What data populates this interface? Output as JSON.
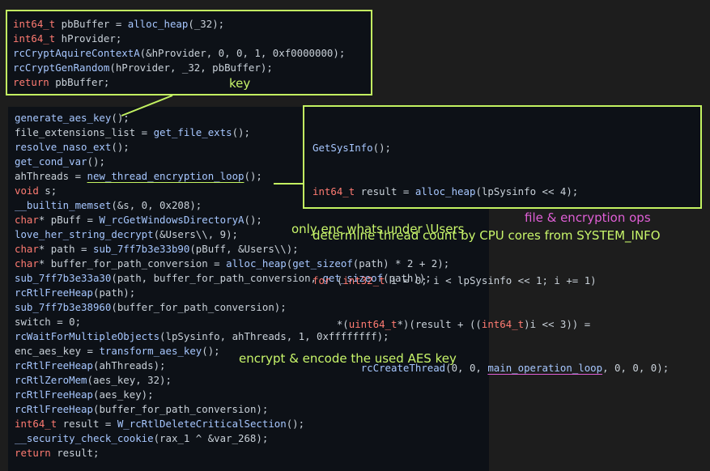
{
  "top_box": {
    "lines": [
      [
        {
          "c": "kw",
          "t": "int64_t"
        },
        {
          "c": "txt",
          "t": " pbBuffer = "
        },
        {
          "c": "fn",
          "t": "alloc_heap"
        },
        {
          "c": "txt",
          "t": "(_32);"
        }
      ],
      [
        {
          "c": "kw",
          "t": "int64_t"
        },
        {
          "c": "txt",
          "t": " hProvider;"
        }
      ],
      [
        {
          "c": "fn",
          "t": "rcCryptAquireContextA"
        },
        {
          "c": "txt",
          "t": "(&hProvider, 0, 0, 1, 0xf0000000);"
        }
      ],
      [
        {
          "c": "fn",
          "t": "rcCryptGenRandom"
        },
        {
          "c": "txt",
          "t": "(hProvider, _32, pbBuffer);"
        }
      ],
      [
        {
          "c": "kw",
          "t": "return"
        },
        {
          "c": "txt",
          "t": " pbBuffer;"
        }
      ]
    ],
    "annotation": "key"
  },
  "main_box": {
    "lines": [
      [
        {
          "c": "fn",
          "t": "generate_aes_key"
        },
        {
          "c": "txt",
          "t": "();"
        }
      ],
      [
        {
          "c": "txt",
          "t": "file_extensions_list = "
        },
        {
          "c": "fn",
          "t": "get_file_exts"
        },
        {
          "c": "txt",
          "t": "();"
        }
      ],
      [
        {
          "c": "fn",
          "t": "resolve_naso_ext"
        },
        {
          "c": "txt",
          "t": "();"
        }
      ],
      [
        {
          "c": "fn",
          "t": "get_cond_var"
        },
        {
          "c": "txt",
          "t": "();"
        }
      ],
      [
        {
          "c": "txt",
          "t": "ahThreads = "
        },
        {
          "c": "fnu",
          "t": "new_thread_encryption_loop"
        },
        {
          "c": "txt",
          "t": "();"
        }
      ],
      [
        {
          "c": "kw",
          "t": "void"
        },
        {
          "c": "txt",
          "t": " s;"
        }
      ],
      [
        {
          "c": "fn",
          "t": "__builtin_memset"
        },
        {
          "c": "txt",
          "t": "(&s, 0, 0x208);"
        }
      ],
      [
        {
          "c": "kw",
          "t": "char"
        },
        {
          "c": "txt",
          "t": "* pBuff = "
        },
        {
          "c": "fn",
          "t": "W_rcGetWindowsDirectoryA"
        },
        {
          "c": "txt",
          "t": "();"
        }
      ],
      [
        {
          "c": "fn",
          "t": "love_her_string_decrypt"
        },
        {
          "c": "txt",
          "t": "(&Users\\\\, 9);"
        }
      ],
      [
        {
          "c": "kw",
          "t": "char"
        },
        {
          "c": "txt",
          "t": "* path = "
        },
        {
          "c": "fn",
          "t": "sub_7ff7b3e33b90"
        },
        {
          "c": "txt",
          "t": "(pBuff, &Users\\\\);"
        }
      ],
      [
        {
          "c": "kw",
          "t": "char"
        },
        {
          "c": "txt",
          "t": "* buffer_for_path_conversion = "
        },
        {
          "c": "fn",
          "t": "alloc_heap"
        },
        {
          "c": "txt",
          "t": "("
        },
        {
          "c": "fn",
          "t": "get_sizeof"
        },
        {
          "c": "txt",
          "t": "(path) * 2 + 2);"
        }
      ],
      [
        {
          "c": "fn",
          "t": "sub_7ff7b3e33a30"
        },
        {
          "c": "txt",
          "t": "(path, buffer_for_path_conversion, "
        },
        {
          "c": "fn",
          "t": "get_sizeof"
        },
        {
          "c": "txt",
          "t": "(path));"
        }
      ],
      [
        {
          "c": "fn",
          "t": "rcRtlFreeHeap"
        },
        {
          "c": "txt",
          "t": "(path);"
        }
      ],
      [
        {
          "c": "fn",
          "t": "sub_7ff7b3e38960"
        },
        {
          "c": "txt",
          "t": "(buffer_for_path_conversion);"
        }
      ],
      [
        {
          "c": "txt",
          "t": "switch = 0;"
        }
      ],
      [
        {
          "c": "fn",
          "t": "rcWaitForMultipleObjects"
        },
        {
          "c": "txt",
          "t": "(lpSysinfo, ahThreads, 1, 0xffffffff);"
        }
      ],
      [
        {
          "c": "txt",
          "t": "enc_aes_key = "
        },
        {
          "c": "fn",
          "t": "transform_aes_key"
        },
        {
          "c": "txt",
          "t": "();"
        }
      ],
      [
        {
          "c": "fn",
          "t": "rcRtlFreeHeap"
        },
        {
          "c": "txt",
          "t": "(ahThreads);"
        }
      ],
      [
        {
          "c": "fn",
          "t": "rcRtlZeroMem"
        },
        {
          "c": "txt",
          "t": "(aes_key, 32);"
        }
      ],
      [
        {
          "c": "fn",
          "t": "rcRtlFreeHeap"
        },
        {
          "c": "txt",
          "t": "(aes_key);"
        }
      ],
      [
        {
          "c": "fn",
          "t": "rcRtlFreeHeap"
        },
        {
          "c": "txt",
          "t": "(buffer_for_path_conversion);"
        }
      ],
      [
        {
          "c": "kw",
          "t": "int64_t"
        },
        {
          "c": "txt",
          "t": " result = "
        },
        {
          "c": "fn",
          "t": "W_rcRtlDeleteCriticalSection"
        },
        {
          "c": "txt",
          "t": "();"
        }
      ],
      [
        {
          "c": "fn",
          "t": "__security_check_cookie"
        },
        {
          "c": "txt",
          "t": "(rax_1 ^ &var_268);"
        }
      ],
      [
        {
          "c": "kw",
          "t": "return"
        },
        {
          "c": "txt",
          "t": " result;"
        }
      ]
    ]
  },
  "right_box": {
    "line1": [
      {
        "c": "fn",
        "t": "GetSysInfo"
      },
      {
        "c": "txt",
        "t": "();"
      }
    ],
    "line2": [
      {
        "c": "kw",
        "t": "int64_t"
      },
      {
        "c": "txt",
        "t": " result = "
      },
      {
        "c": "fn",
        "t": "alloc_heap"
      },
      {
        "c": "txt",
        "t": "(lpSysinfo << 4);"
      }
    ],
    "annotation": "determine thread count by CPU cores from SYSTEM_INFO",
    "line4": [
      {
        "c": "kw",
        "t": "for"
      },
      {
        "c": "txt",
        "t": " ("
      },
      {
        "c": "kw",
        "t": "int32_t"
      },
      {
        "c": "txt",
        "t": " i = 0; i < lpSysinfo << 1; i += 1)"
      }
    ],
    "line5": [
      {
        "c": "txt",
        "t": "    *("
      },
      {
        "c": "kw",
        "t": "uint64_t"
      },
      {
        "c": "txt",
        "t": "*)(result + (("
      },
      {
        "c": "kw",
        "t": "int64_t"
      },
      {
        "c": "txt",
        "t": ")i << 3)) ="
      }
    ],
    "line6": [
      {
        "c": "txt",
        "t": "        "
      },
      {
        "c": "fn",
        "t": "rcCreateThread"
      },
      {
        "c": "txt",
        "t": "(0, 0, "
      },
      {
        "c": "fnp",
        "t": "main_operation_loop"
      },
      {
        "c": "txt",
        "t": ", 0, 0, 0);"
      }
    ]
  },
  "annotations": {
    "file_ops": "file & encryption ops",
    "users_only": "only enc whats under \\Users",
    "encrypt_key": "encrypt & encode the used AES key"
  },
  "colors": {
    "highlight_border": "#c3f261",
    "keyword": "#ff7b72",
    "function": "#a7c7ff",
    "annotation_green": "#c8f56a",
    "annotation_pink": "#e05fd6"
  }
}
